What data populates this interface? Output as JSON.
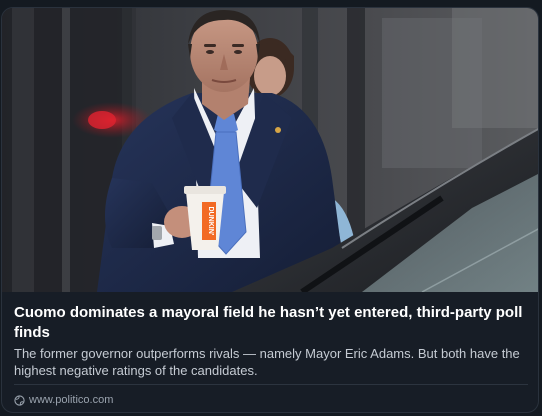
{
  "card": {
    "headline": "Cuomo dominates a mayoral field he hasn’t yet entered, third-party poll finds",
    "description": "The former governor outperforms rivals — namely Mayor Eric Adams. But both have the highest negative ratings of the candidates.",
    "source": {
      "icon": "globe-icon",
      "domain": "www.politico.com"
    },
    "cup_text": "DUNKIN'"
  },
  "colors": {
    "card_background": "#171d26",
    "headline": "#ffffff",
    "description": "#c5cbd3",
    "source": "#9aa3ae",
    "suit": "#1c2a4a",
    "tie": "#5f86d6",
    "cup_logo": "#f26a24"
  }
}
